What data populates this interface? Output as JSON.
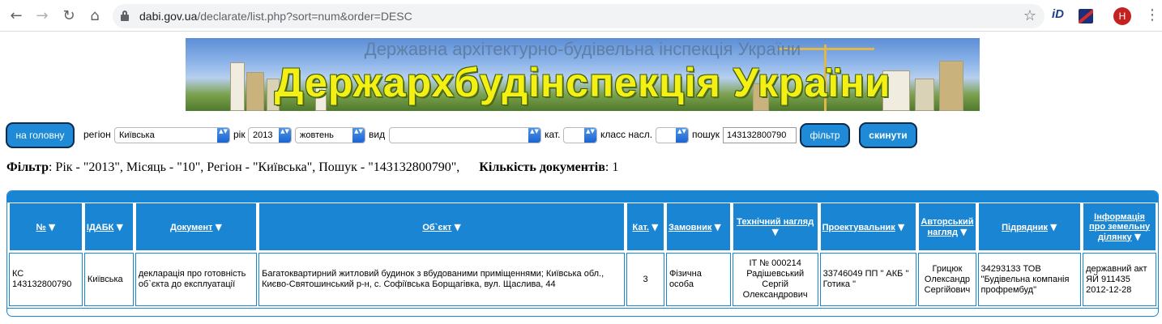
{
  "browser": {
    "back_icon": "←",
    "forward_icon": "→",
    "reload_icon": "↻",
    "home_icon": "⌂",
    "url_host": "dabi.gov.ua",
    "url_path": "/declarate/list.php?sort=num&order=DESC",
    "star_icon": "☆",
    "ext_id_label": "iD",
    "avatar_letter": "H",
    "menu_icon": "⋮"
  },
  "banner": {
    "subtitle": "Державна архітектурно-будівельна інспекція України",
    "title": "Держархбудінспекція України"
  },
  "filters": {
    "home_button": "на головну",
    "region_label": "регіон",
    "region_value": "Київська",
    "year_label": "рік",
    "year_value": "2013",
    "month_value": "жовтень",
    "type_label": "вид",
    "type_value": "",
    "cat_label": "кат.",
    "cat_value": "",
    "class_label": "класс насл.",
    "class_value": "",
    "search_label": "пошук",
    "search_value": "143132800790",
    "filter_button": "фільтр",
    "reset_button": "скинути",
    "select_arrow": "▲▼"
  },
  "filter_summary": {
    "filter_label": "Фільтр",
    "filter_text": ": Рік - \"2013\", Місяць - \"10\", Регіон - \"Київська\", Пошук - \"143132800790\",",
    "count_label": "Кількість документів",
    "count_text": ": 1"
  },
  "table": {
    "sort_icon": "▼",
    "headers": {
      "num": "№",
      "idabk": "ІДАБК",
      "document": "Документ",
      "object": "Об`єкт",
      "cat": "Кат.",
      "customer": "Замовник",
      "tech_supervision": "Технічний нагляд",
      "designer": "Проектувальник",
      "author_supervision": "Авторський нагляд",
      "contractor": "Підрядник",
      "land_info": "Інформація про земельну ділянку"
    },
    "rows": [
      {
        "num": "КС 143132800790",
        "idabk": "Київська",
        "document": "декларація про готовність об`єкта до експлуатації",
        "object": "Багатоквартирний житловий будинок з вбудованими приміщеннями; Київська обл., Києво-Святошинський р-н, с. Софіївська Борщагівка, вул. Щаслива, 44",
        "cat": "3",
        "customer": "Фізична особа",
        "tech_supervision": "ІТ № 000214 Радішевський Сергій Олександрович",
        "designer": "33746049 ПП \" АКБ \" Готика \"",
        "author_supervision": "Грицюк Олександр Сергійович",
        "contractor": "34293133 ТОВ \"Будівельна компанія профрембуд\"",
        "land_info": "державний акт ЯЙ 911435 2012-12-28"
      }
    ]
  },
  "colors": {
    "accent": "#1a86d3",
    "button": "#1f8ad6",
    "banner_title": "#f4f014"
  }
}
